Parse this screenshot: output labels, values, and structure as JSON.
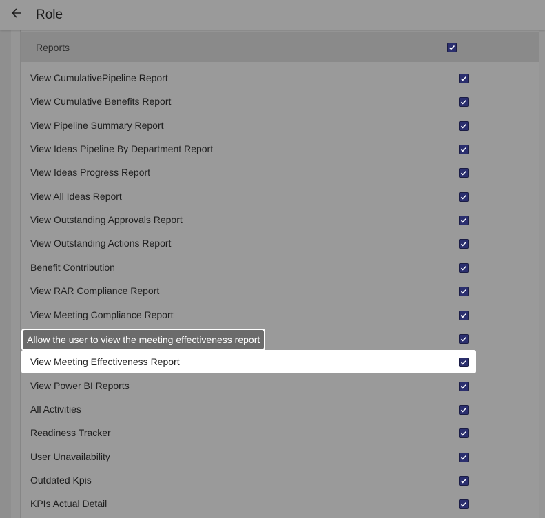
{
  "header": {
    "title": "Role",
    "back_icon": "arrow-left-icon"
  },
  "section": {
    "title": "Reports",
    "checked": true
  },
  "tooltip": "Allow the user to view the meeting effectiveness report",
  "rows": [
    {
      "label": "View CumulativePipeline Report",
      "checked": true
    },
    {
      "label": "View Cumulative Benefits Report",
      "checked": true
    },
    {
      "label": "View Pipeline Summary Report",
      "checked": true
    },
    {
      "label": "View Ideas Pipeline By Department Report",
      "checked": true
    },
    {
      "label": "View Ideas Progress Report",
      "checked": true
    },
    {
      "label": "View All Ideas Report",
      "checked": true
    },
    {
      "label": "View Outstanding Approvals Report",
      "checked": true
    },
    {
      "label": "View Outstanding Actions Report",
      "checked": true
    },
    {
      "label": "Benefit Contribution",
      "checked": true
    },
    {
      "label": "View RAR Compliance Report",
      "checked": true
    },
    {
      "label": "View Meeting Compliance Report",
      "checked": true
    },
    {
      "label": "",
      "checked": true
    },
    {
      "label": "View Meeting Effectiveness Report",
      "checked": true,
      "highlighted": true
    },
    {
      "label": "View Power BI Reports",
      "checked": true
    },
    {
      "label": "All Activities",
      "checked": true
    },
    {
      "label": "Readiness Tracker",
      "checked": true
    },
    {
      "label": "User Unavailability",
      "checked": true
    },
    {
      "label": "Outdated Kpis",
      "checked": true
    },
    {
      "label": "KPIs Actual Detail",
      "checked": true
    }
  ],
  "colors": {
    "checkbox": "#2b2f6e",
    "overlay": "#9a9a9a",
    "highlight": "#ffffff"
  }
}
